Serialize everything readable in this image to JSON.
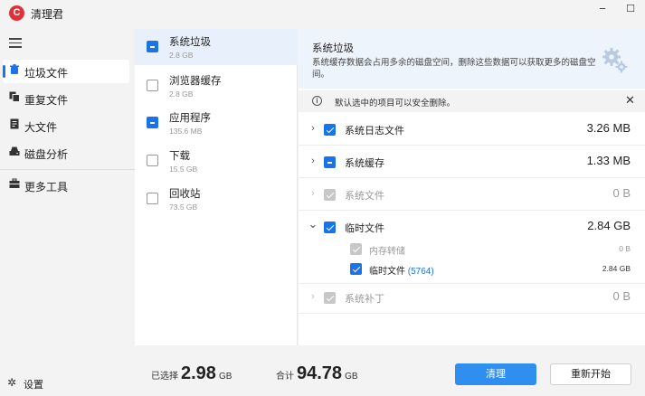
{
  "app": {
    "title": "清理君",
    "logo_text": "C"
  },
  "window": {
    "minimize": "−",
    "maximize": "☐"
  },
  "sidebar": {
    "items": [
      {
        "label": "垃圾文件",
        "icon": "trash-icon",
        "active": true
      },
      {
        "label": "重复文件",
        "icon": "duplicate-icon",
        "active": false
      },
      {
        "label": "大文件",
        "icon": "file-icon",
        "active": false
      },
      {
        "label": "磁盘分析",
        "icon": "disk-icon",
        "active": false
      },
      {
        "label": "更多工具",
        "icon": "toolbox-icon",
        "active": false
      }
    ],
    "settings_label": "设置"
  },
  "categories": [
    {
      "name": "系统垃圾",
      "size": "2.8 GB",
      "state": "partial",
      "active": true
    },
    {
      "name": "浏览器缓存",
      "size": "2.8 GB",
      "state": "unchecked",
      "active": false
    },
    {
      "name": "应用程序",
      "size": "135.6 MB",
      "state": "partial",
      "active": false
    },
    {
      "name": "下载",
      "size": "15.5 GB",
      "state": "unchecked",
      "active": false
    },
    {
      "name": "回收站",
      "size": "73.5 GB",
      "state": "unchecked",
      "active": false
    }
  ],
  "detail": {
    "title": "系统垃圾",
    "description": "系统缓存数据会占用多余的磁盘空间，删除这些数据可以获取更多的磁盘空间。",
    "notice": "默认选中的项目可以安全删除。",
    "notice_close": "✕",
    "rows": [
      {
        "name": "系统日志文件",
        "size": "3.26 MB",
        "state": "checked",
        "chevron": "›",
        "disabled": false
      },
      {
        "name": "系统缓存",
        "size": "1.33 MB",
        "state": "partial",
        "chevron": "›",
        "disabled": false
      },
      {
        "name": "系统文件",
        "size": "0 B",
        "state": "disabled",
        "chevron": "›",
        "disabled": true
      },
      {
        "name": "临时文件",
        "size": "2.84 GB",
        "state": "checked",
        "chevron": "⌄",
        "disabled": false
      },
      {
        "name": "系统补丁",
        "size": "0 B",
        "state": "disabled",
        "chevron": "›",
        "disabled": true
      }
    ],
    "subrows": [
      {
        "name": "内存转储",
        "count": "",
        "size": "0 B",
        "state": "disabled",
        "disabled": true
      },
      {
        "name": "临时文件",
        "count": "(5764)",
        "size": "2.84 GB",
        "state": "checked",
        "disabled": false
      }
    ]
  },
  "footer": {
    "selected_label": "已选择",
    "selected_value": "2.98",
    "selected_unit": "GB",
    "total_label": "合计",
    "total_value": "94.78",
    "total_unit": "GB",
    "clean_label": "清理",
    "restart_label": "重新开始"
  }
}
